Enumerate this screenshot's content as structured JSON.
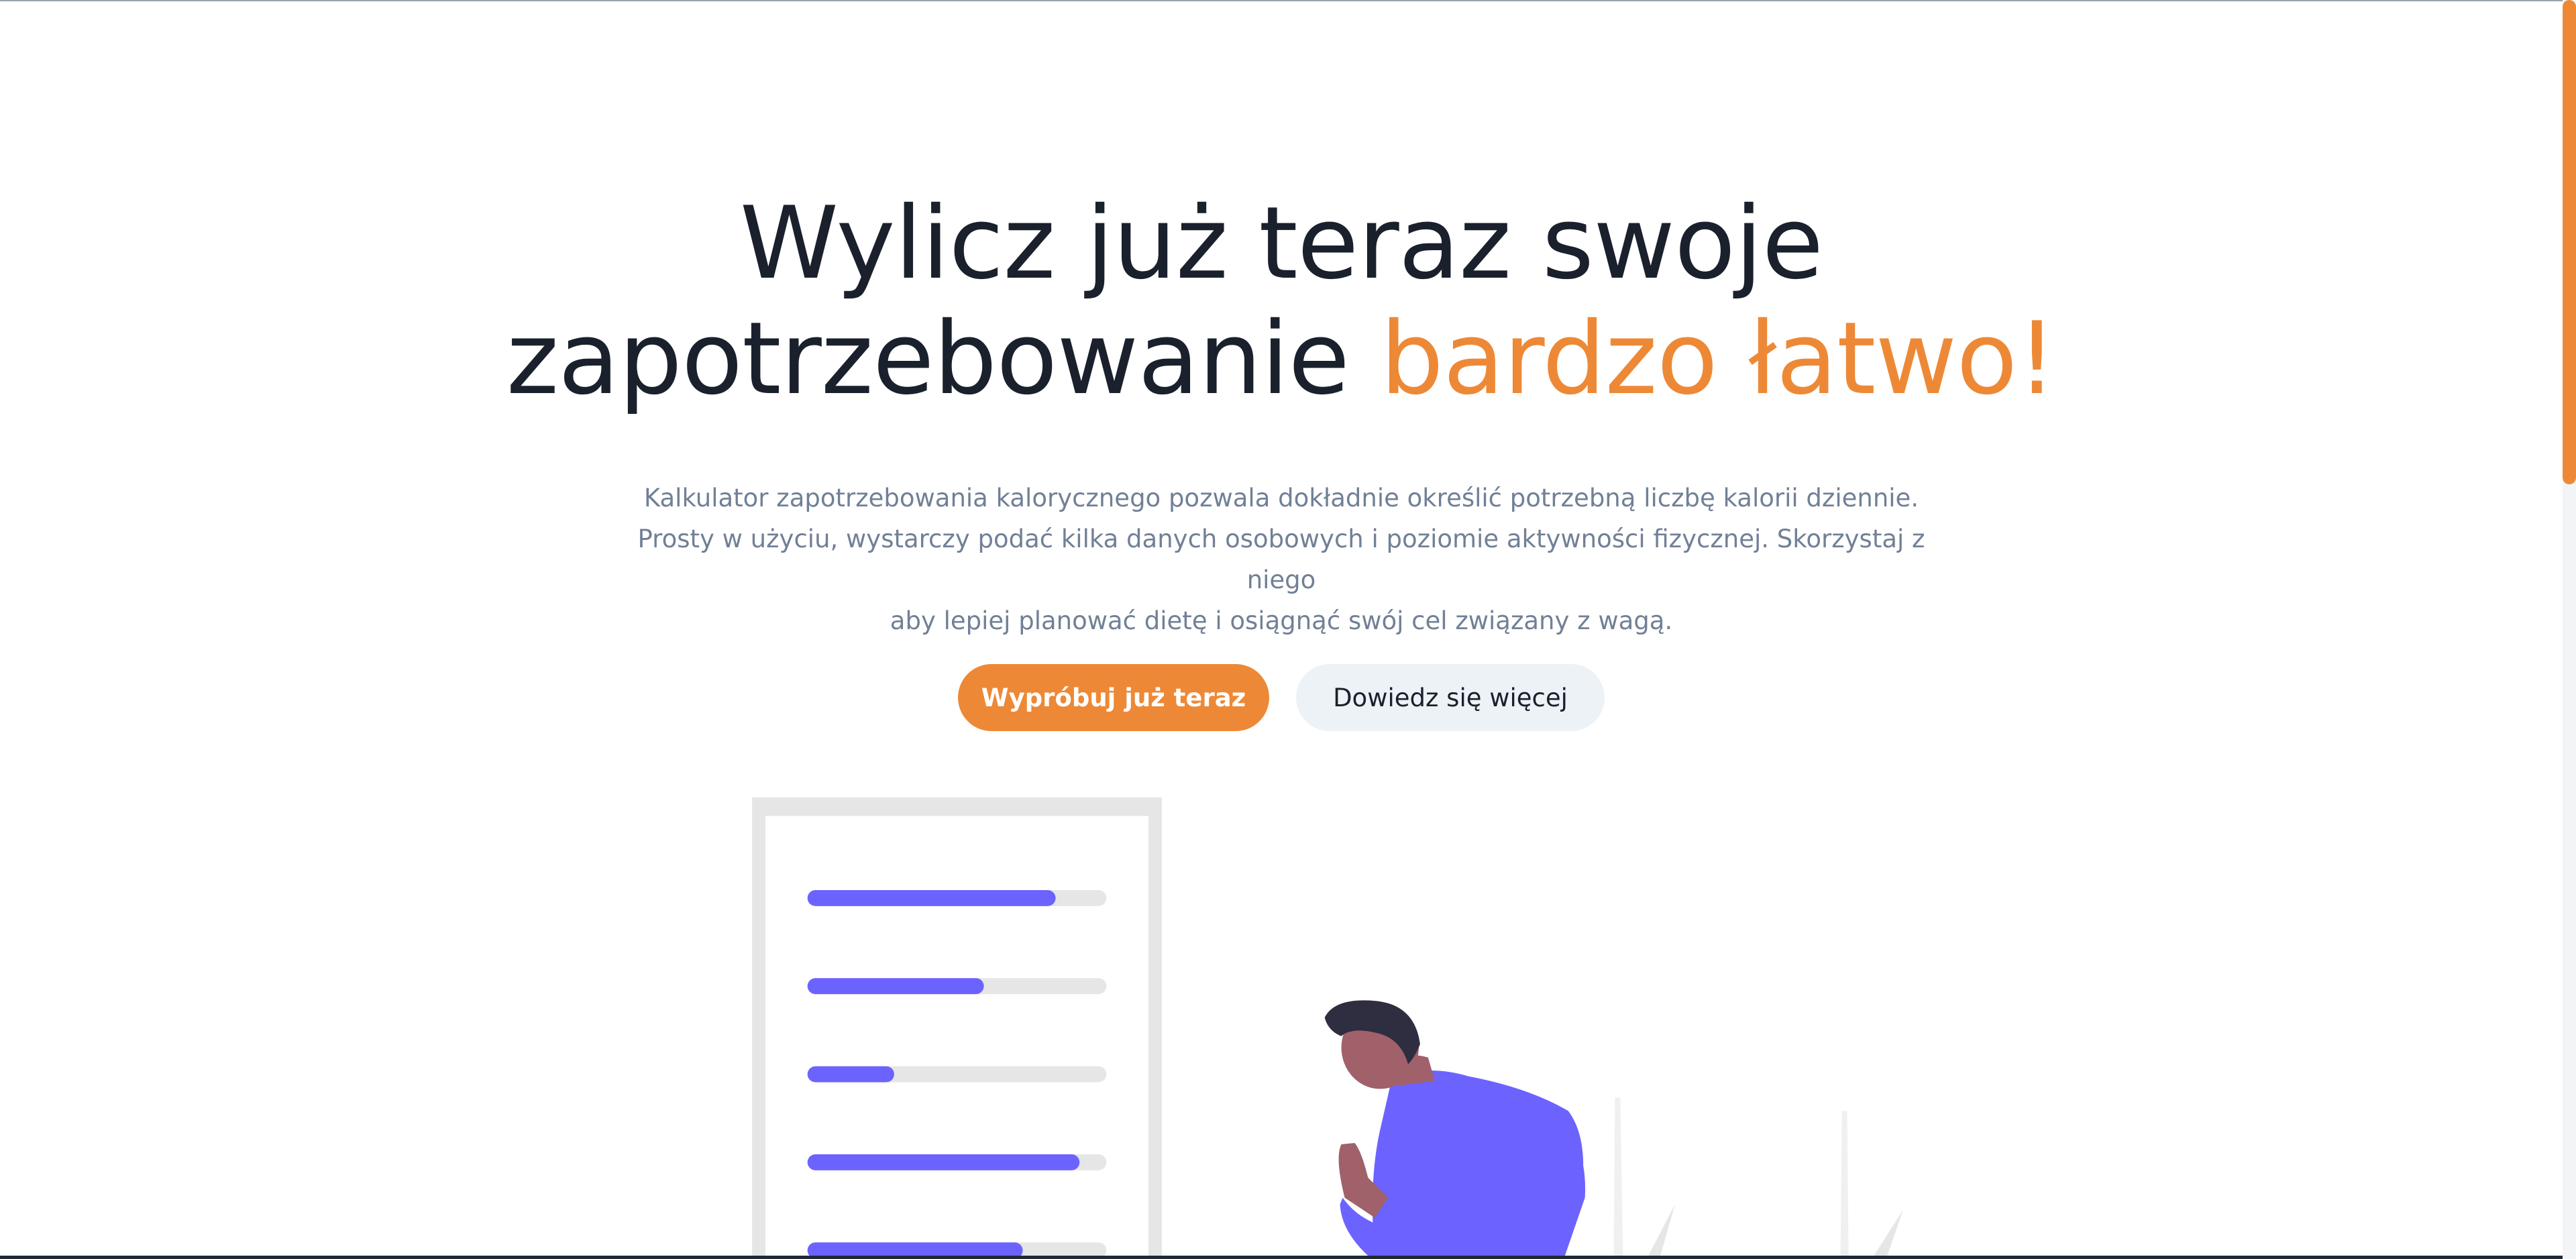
{
  "hero": {
    "headline_line1": "Wylicz już teraz swoje",
    "headline_line2": "zapotrzebowanie",
    "headline_accent": "bardzo łatwo!",
    "subtitle_line1": "Kalkulator zapotrzebowania kalorycznego pozwala dokładnie określić potrzebną liczbę kalorii dziennie.",
    "subtitle_line2": "Prosty w użyciu, wystarczy podać kilka danych osobowych i poziomie aktywności fizycznej. Skorzystaj z niego",
    "subtitle_line3": "aby lepiej planować dietę i osiągnąć swój cel związany z wagą.",
    "primary_button": "Wypróbuj już teraz",
    "secondary_button": "Dowiedz się więcej"
  },
  "illustration": {
    "progress_levels": [
      0.83,
      0.59,
      0.29,
      0.91,
      0.72
    ]
  },
  "colors": {
    "accent": "#ed8936",
    "heading": "#1a202c",
    "muted_text": "#718096",
    "secondary_button_bg": "#edf2f7",
    "illustration_purple": "#6c63ff"
  }
}
